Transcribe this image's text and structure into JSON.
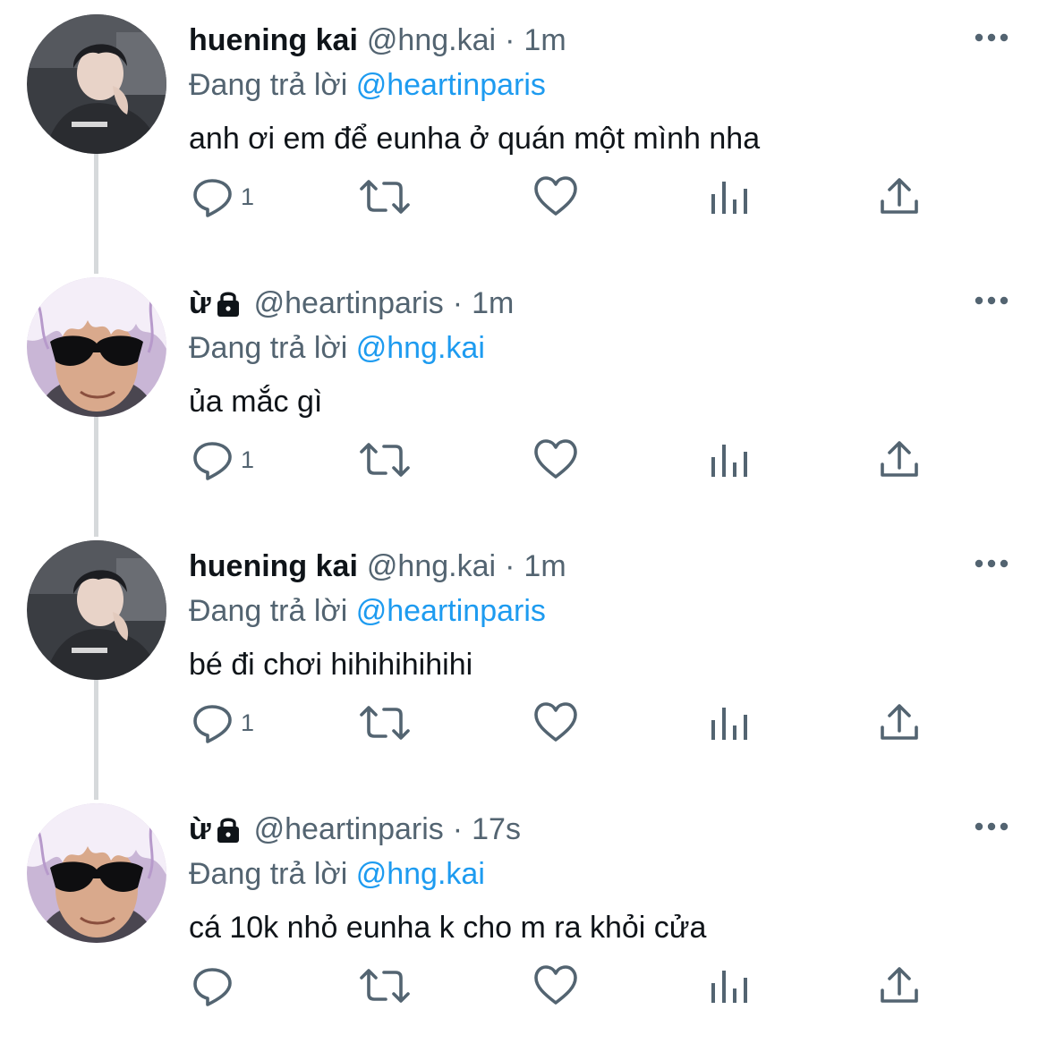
{
  "tweets": [
    {
      "author": "a",
      "display_name": "huening kai",
      "protected": false,
      "handle": "@hng.kai",
      "separator": "·",
      "time": "1m",
      "reply_prefix": "Đang trả lời",
      "reply_to": "@heartinparis",
      "text": "anh ơi em để eunha ở quán một mình nha",
      "reply_count": "1"
    },
    {
      "author": "b",
      "display_name": "ừ",
      "protected": true,
      "handle": "@heartinparis",
      "separator": "·",
      "time": "1m",
      "reply_prefix": "Đang trả lời",
      "reply_to": "@hng.kai",
      "text": "ủa mắc gì",
      "reply_count": "1"
    },
    {
      "author": "a",
      "display_name": "huening kai",
      "protected": false,
      "handle": "@hng.kai",
      "separator": "·",
      "time": "1m",
      "reply_prefix": "Đang trả lời",
      "reply_to": "@heartinparis",
      "text": "bé đi chơi hihihihihihi",
      "reply_count": "1"
    },
    {
      "author": "b",
      "display_name": "ừ",
      "protected": true,
      "handle": "@heartinparis",
      "separator": "·",
      "time": "17s",
      "reply_prefix": "Đang trả lời",
      "reply_to": "@hng.kai",
      "text": "cá 10k nhỏ eunha k cho m ra khỏi cửa",
      "reply_count": ""
    }
  ],
  "icons": {
    "reply": "reply-icon",
    "retweet": "retweet-icon",
    "like": "heart-icon",
    "views": "analytics-icon",
    "share": "share-icon",
    "more": "more-icon",
    "lock": "lock-icon"
  },
  "colors": {
    "text": "#0f1419",
    "secondary": "#536471",
    "link": "#1d9bf0",
    "thread_line": "#d6d9db"
  }
}
